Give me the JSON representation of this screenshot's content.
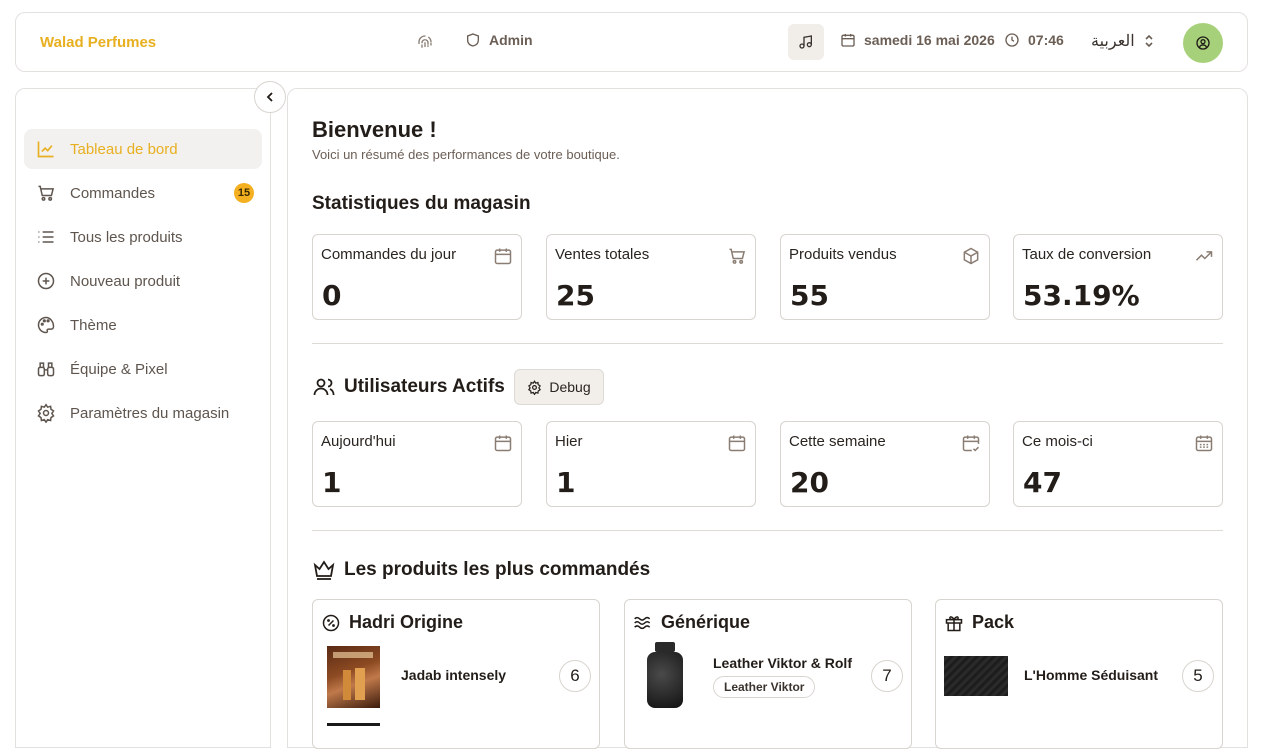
{
  "header": {
    "brand": "Walad Perfumes",
    "role": "Admin",
    "date": "samedi 16 mai 2026",
    "time": "07:46",
    "language": "العربية"
  },
  "sidebar": {
    "items": [
      {
        "label": "Tableau de bord",
        "icon": "chart-icon",
        "active": true
      },
      {
        "label": "Commandes",
        "icon": "cart-icon",
        "badge": "15"
      },
      {
        "label": "Tous les produits",
        "icon": "list-icon"
      },
      {
        "label": "Nouveau produit",
        "icon": "plus-circle-icon"
      },
      {
        "label": "Thème",
        "icon": "palette-icon"
      },
      {
        "label": "Équipe & Pixel",
        "icon": "binoculars-icon"
      },
      {
        "label": "Paramètres du magasin",
        "icon": "gear-icon"
      }
    ]
  },
  "main": {
    "title": "Bienvenue !",
    "subtitle": "Voici un résumé des performances de votre boutique.",
    "store_stats": {
      "title": "Statistiques du magasin",
      "cards": [
        {
          "label": "Commandes du jour",
          "value": "0",
          "icon": "calendar-icon"
        },
        {
          "label": "Ventes totales",
          "value": "25",
          "icon": "cart-icon"
        },
        {
          "label": "Produits vendus",
          "value": "55",
          "icon": "box-icon"
        },
        {
          "label": "Taux de conversion",
          "value": "53.19%",
          "icon": "trending-up-icon"
        }
      ]
    },
    "active_users": {
      "title": "Utilisateurs Actifs",
      "debug_label": "Debug",
      "cards": [
        {
          "label": "Aujourd'hui",
          "value": "1",
          "icon": "calendar-icon"
        },
        {
          "label": "Hier",
          "value": "1",
          "icon": "calendar-icon"
        },
        {
          "label": "Cette semaine",
          "value": "20",
          "icon": "calendar-check-icon"
        },
        {
          "label": "Ce mois-ci",
          "value": "47",
          "icon": "calendar-grid-icon"
        }
      ]
    },
    "top_products": {
      "title": "Les produits les plus commandés",
      "groups": [
        {
          "title": "Hadri Origine",
          "icon": "percent-badge-icon",
          "product": "Jadab intensely",
          "count": "6"
        },
        {
          "title": "Générique",
          "icon": "waves-icon",
          "product": "Leather Viktor & Rolf",
          "tag": "Leather Viktor",
          "count": "7"
        },
        {
          "title": "Pack",
          "icon": "gift-icon",
          "product": "L'Homme Séduisant",
          "count": "5"
        }
      ]
    }
  },
  "colors": {
    "accent": "#e8b020",
    "badge": "#f4b020",
    "avatar": "#a6d17a"
  }
}
